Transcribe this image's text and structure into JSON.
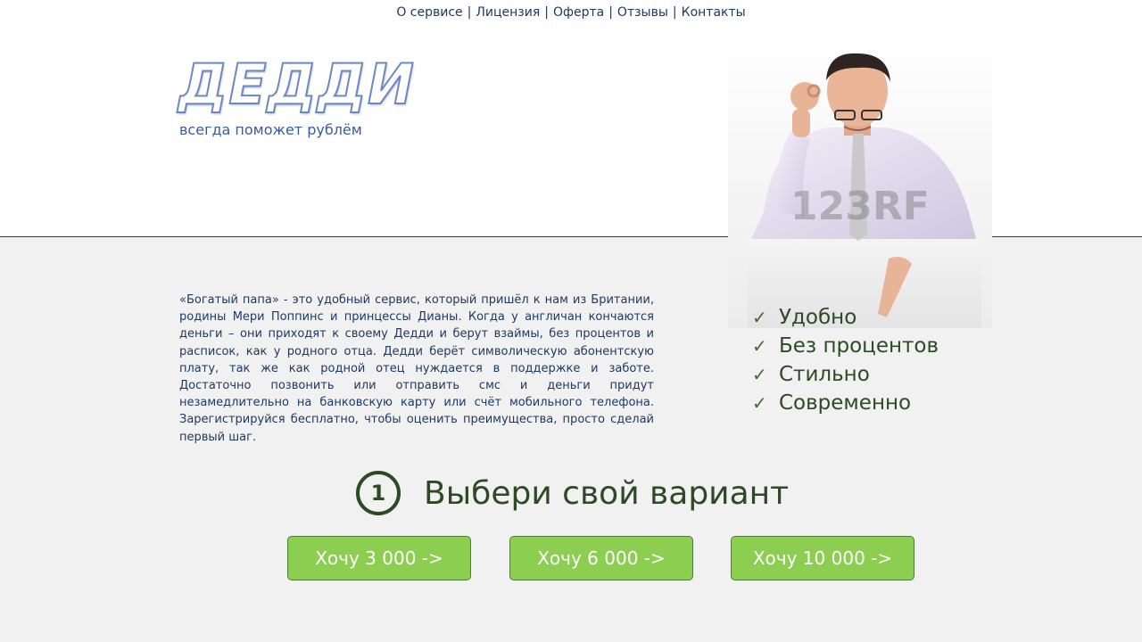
{
  "nav": {
    "items": [
      "О сервисе",
      "Лицензия",
      "Оферта",
      "Отзывы",
      "Контакты"
    ],
    "separator": "|"
  },
  "logo": {
    "text": "ДЕДДИ",
    "tagline": "всегда поможет рублём"
  },
  "hero_image": {
    "watermark": "123RF"
  },
  "description": "«Богатый папа» - это удобный сервис, который пришёл к нам из Британии, родины Мери Поппинс и принцессы Дианы. Когда у англичан кончаются деньги – они приходят к своему Дедди и берут взаймы, без процентов и расписок, как у родного отца. Дедди берёт символическую абонентскую плату, так же как родной отец нуждается в поддержке и заботе. Достаточно позвонить или отправить смс и деньги придут незамедлительно на банковскую карту или счёт мобильного телефона. Зарегистрируйся бесплатно, чтобы оценить преимущества, просто сделай первый шаг.",
  "features": {
    "check_symbol": "✓",
    "items": [
      "Удобно",
      "Без процентов",
      "Стильно",
      "Современно"
    ]
  },
  "step": {
    "number": "1",
    "title": "Выбери свой вариант"
  },
  "options": [
    {
      "label": "Хочу 3 000 ->"
    },
    {
      "label": "Хочу 6 000 ->"
    },
    {
      "label": "Хочу 10 000 ->"
    }
  ],
  "colors": {
    "accent_green": "#8ccf50",
    "text_dark_green": "#2e4a25",
    "text_navy": "#1d3a63"
  }
}
